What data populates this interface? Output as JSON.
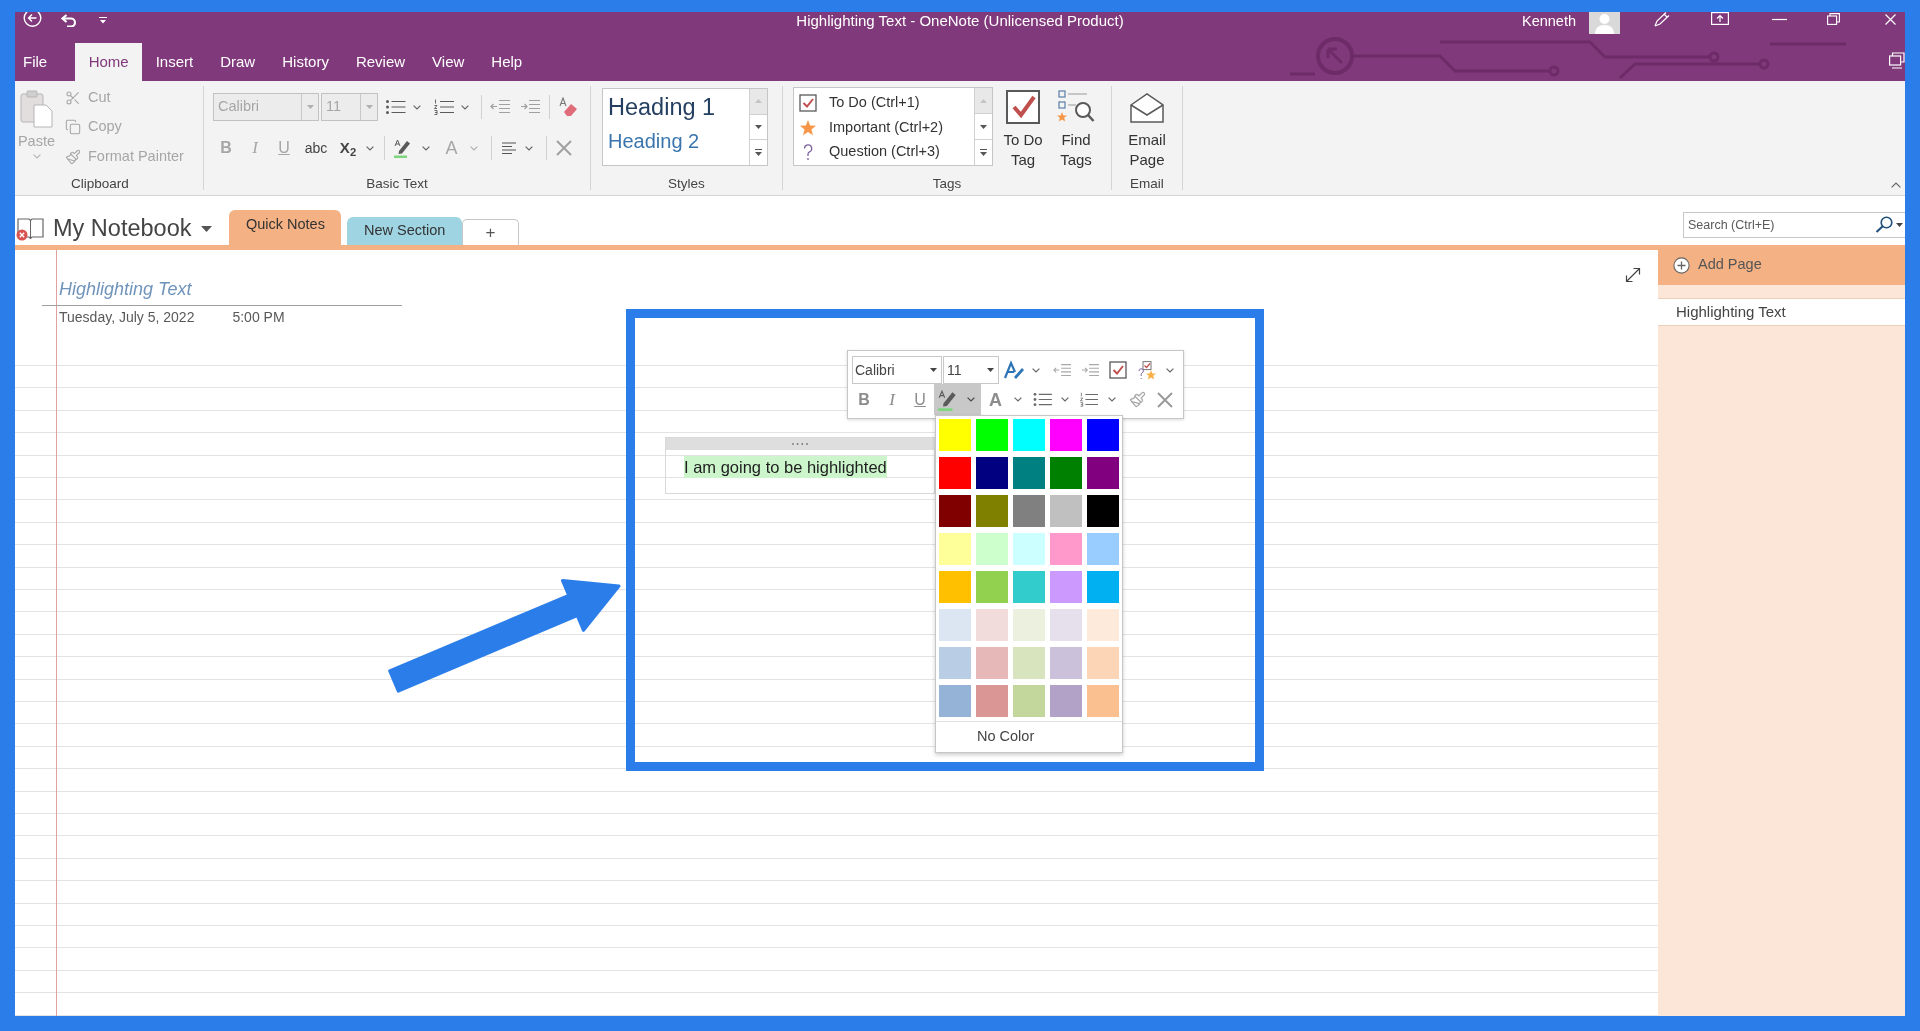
{
  "title_bar": {
    "title": "Highlighting Text - OneNote (Unlicensed Product)",
    "user": "Kenneth"
  },
  "ribbon_tabs": [
    {
      "label": "File",
      "selected": false
    },
    {
      "label": "Home",
      "selected": true
    },
    {
      "label": "Insert",
      "selected": false
    },
    {
      "label": "Draw",
      "selected": false
    },
    {
      "label": "History",
      "selected": false
    },
    {
      "label": "Review",
      "selected": false
    },
    {
      "label": "View",
      "selected": false
    },
    {
      "label": "Help",
      "selected": false
    }
  ],
  "clipboard": {
    "group_label": "Clipboard",
    "paste": {
      "label": "Paste",
      "disabled": true
    },
    "commands": [
      {
        "kind": "cut",
        "label": "Cut",
        "disabled": true
      },
      {
        "kind": "copy",
        "label": "Copy",
        "disabled": true
      },
      {
        "kind": "format-painter",
        "label": "Format Painter",
        "disabled": true
      }
    ]
  },
  "basic_text": {
    "group_label": "Basic Text",
    "font": {
      "value": "Calibri",
      "disabled": true
    },
    "size": {
      "value": "11",
      "disabled": true
    },
    "format_buttons": [
      {
        "kind": "bold",
        "label": "B",
        "disabled": true
      },
      {
        "kind": "italic",
        "label": "I",
        "disabled": true
      },
      {
        "kind": "underline",
        "label": "U",
        "disabled": true
      },
      {
        "kind": "strikethrough",
        "label": "abc",
        "disabled": false
      },
      {
        "kind": "subscript",
        "label": "X$_{2}$",
        "disabled": false
      }
    ],
    "font_color": {
      "label": "A",
      "disabled": true
    }
  },
  "styles": {
    "group_label": "Styles",
    "items": [
      {
        "label": "Heading 1"
      },
      {
        "label": "Heading 2"
      }
    ]
  },
  "tags": {
    "group_label": "Tags",
    "items": [
      {
        "kind": "todo",
        "label": "To Do (Ctrl+1)"
      },
      {
        "kind": "important",
        "label": "Important (Ctrl+2)"
      },
      {
        "kind": "question",
        "label": "Question (Ctrl+3)"
      }
    ],
    "buttons": [
      {
        "kind": "todo-tag",
        "label": "To Do Tag"
      },
      {
        "kind": "find-tags",
        "label": "Find Tags"
      }
    ]
  },
  "email": {
    "group_label": "Email",
    "button": {
      "label": "Email Page"
    }
  },
  "notebook": {
    "name": "My Notebook",
    "sections": [
      {
        "label": "Quick Notes",
        "selected": true,
        "color": "#f4b183"
      },
      {
        "label": "New Section",
        "selected": false,
        "color": "#9fd4e3"
      }
    ],
    "add_section": "+"
  },
  "page": {
    "title": "Highlighting Text",
    "date": "Tuesday, July 5, 2022",
    "time": "5:00 PM",
    "note": {
      "text": "I am going to be highlighted",
      "highlighted": true
    }
  },
  "mini_toolbar": {
    "font": "Calibri",
    "size": "11",
    "format_buttons": [
      {
        "kind": "bold",
        "label": "B"
      },
      {
        "kind": "italic",
        "label": "I"
      },
      {
        "kind": "underline",
        "label": "U"
      }
    ],
    "highlight": {
      "expanded": true
    },
    "font_color": {
      "label": "A"
    }
  },
  "highlight_palette": {
    "swatches": [
      {
        "color": "#ffff00"
      },
      {
        "color": "#00ff00"
      },
      {
        "color": "#00ffff"
      },
      {
        "color": "#ff00ff"
      },
      {
        "color": "#0000ff"
      },
      {
        "color": "#ff0000"
      },
      {
        "color": "#000080"
      },
      {
        "color": "#008080"
      },
      {
        "color": "#008000"
      },
      {
        "color": "#800080"
      },
      {
        "color": "#800000"
      },
      {
        "color": "#808000"
      },
      {
        "color": "#808080"
      },
      {
        "color": "#c0c0c0"
      },
      {
        "color": "#000000"
      },
      {
        "color": "#ffff99"
      },
      {
        "color": "#ccffcc"
      },
      {
        "color": "#ccffff"
      },
      {
        "color": "#ff99cc"
      },
      {
        "color": "#99ccff"
      },
      {
        "color": "#ffc000"
      },
      {
        "color": "#92d050"
      },
      {
        "color": "#33cccc"
      },
      {
        "color": "#cc99ff"
      },
      {
        "color": "#00b0f0"
      },
      {
        "color": "#dce6f2"
      },
      {
        "color": "#f2dcdb"
      },
      {
        "color": "#ebf1de"
      },
      {
        "color": "#e6e0ec"
      },
      {
        "color": "#fdeada"
      },
      {
        "color": "#b9cde5"
      },
      {
        "color": "#e6b9b8"
      },
      {
        "color": "#d7e4bd"
      },
      {
        "color": "#ccc1da"
      },
      {
        "color": "#fbd5b5"
      },
      {
        "color": "#95b3d7"
      },
      {
        "color": "#d99694"
      },
      {
        "color": "#c3d69b"
      },
      {
        "color": "#b3a2c7"
      },
      {
        "color": "#fac090"
      }
    ],
    "no_color": "No Color"
  },
  "search": {
    "placeholder": "Search (Ctrl+E)"
  },
  "pages_pane": {
    "add_page": "Add Page",
    "pages": [
      {
        "title": "Highlighting Text",
        "selected": true
      }
    ]
  }
}
